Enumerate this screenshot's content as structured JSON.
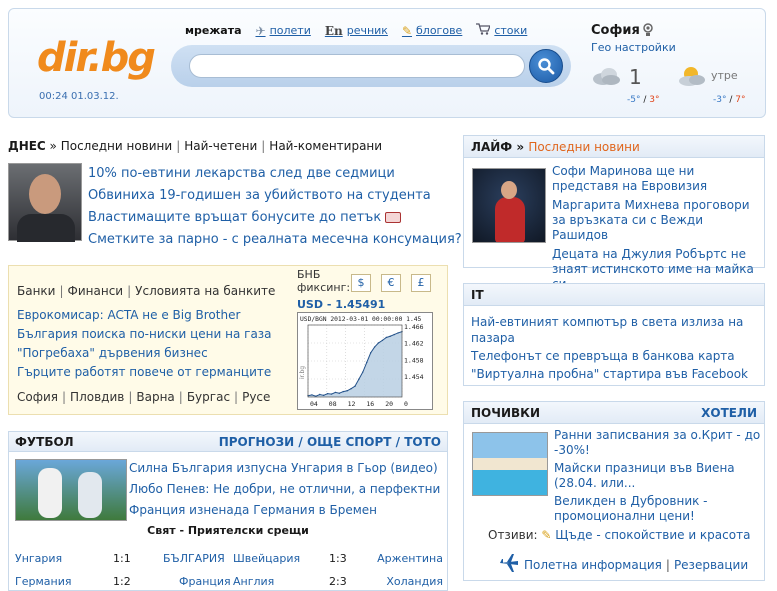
{
  "header": {
    "logo": "dir.bg",
    "clock": "00:24 01.03.12.",
    "tabs": [
      {
        "label": "мрежата",
        "icon": ""
      },
      {
        "label": "полети",
        "icon": "airplane-icon"
      },
      {
        "label": "речник",
        "icon": "En"
      },
      {
        "label": "блогове",
        "icon": "pencil-icon"
      },
      {
        "label": "стоки",
        "icon": "cart-icon"
      }
    ],
    "search": {
      "placeholder": "",
      "value": ""
    }
  },
  "weather": {
    "city": "София",
    "geo_link": "Гео настройки",
    "today": {
      "value": "1",
      "min": "-5°",
      "max": "3°"
    },
    "tomorrow": {
      "label": "утре",
      "min": "-3°",
      "max": "7°"
    }
  },
  "today": {
    "heading": "ДНЕС",
    "links": [
      "Последни новини",
      "Най-четени",
      "Най-коментирани"
    ],
    "headlines": [
      "10% по-евтини лекарства след две седмици",
      "Обвиниха 19-годишен за убийството на студента",
      "Властимащите връщат бонусите до петък",
      "Сметките за парно - с реалната месечна консумация?"
    ]
  },
  "finance": {
    "categories": [
      "Банки",
      "Финанси",
      "Условията на банките"
    ],
    "headlines": [
      "Еврокомисар: ACTA не е Big Brother",
      "България поиска по-ниски цени на газа",
      "\"Погребаха\" дървения бизнес",
      "Гърците работят повече от германците"
    ],
    "cities": [
      "София",
      "Пловдив",
      "Варна",
      "Бургас",
      "Русе"
    ],
    "bnb_label_1": "БНБ",
    "bnb_label_2": "фиксинг:",
    "currencies": [
      "$",
      "€",
      "£"
    ],
    "usd_rate": "USD - 1.45491",
    "chart_title": "USD/BGN 2012-03-01 00:00:00 1.45",
    "chart_watermark": "ir.bg"
  },
  "chart_data": {
    "type": "line",
    "title": "USD/BGN 2012-03-01 00:00:00 1.45",
    "xlabel": "",
    "ylabel": "",
    "x_tick_labels": [
      "04",
      "08",
      "12",
      "16",
      "20",
      "0"
    ],
    "y_tick_labels": [
      "1.466",
      "1.462",
      "1.458",
      "1.454"
    ],
    "y": [
      1.4495,
      1.4497,
      1.4494,
      1.4498,
      1.4496,
      1.45,
      1.4499,
      1.4503,
      1.4501,
      1.4505,
      1.4507,
      1.4512,
      1.4518,
      1.4535,
      1.4552,
      1.4575,
      1.4598,
      1.4612,
      1.4622,
      1.4628,
      1.4635,
      1.4638,
      1.4642,
      1.4646,
      1.4649
    ],
    "ylim": [
      1.4492,
      1.4665
    ],
    "grid": true
  },
  "football": {
    "title": "ФУТБОЛ",
    "links": [
      "ПРОГНОЗИ",
      "ОЩЕ СПОРТ",
      "ТОТО"
    ],
    "headlines": [
      "Силна България изпусна Унгария в Гьор (видео)",
      "Любо Пенев: Не добри, не отлични, а перфектни",
      "Франция изненада Германия в Бремен"
    ],
    "subtitle": "Свят - Приятелски срещи",
    "matches": [
      {
        "home": "Унгария",
        "score": "1:1",
        "away": "БЪЛГАРИЯ",
        "home2": "Швейцария",
        "score2": "1:3",
        "away2": "Аржентина"
      },
      {
        "home": "Германия",
        "score": "1:2",
        "away": "Франция",
        "home2": "Англия",
        "score2": "2:3",
        "away2": "Холандия"
      }
    ]
  },
  "life": {
    "title": "ЛАЙФ",
    "sub": "Последни новини",
    "headlines": [
      "Софи Маринова ще ни представя на Евровизия",
      "Маргарита Михнева проговори за връзката си с Вежди Рашидов",
      "Децата на Джулия Робъртс не знаят истинското име на майка си"
    ]
  },
  "it": {
    "title": "IT",
    "headlines": [
      "Най-евтиният компютър в света излиза на пазара",
      "Телефонът се превръща в банкова карта",
      "\"Виртуална пробна\" стартира във Facebook"
    ]
  },
  "rest": {
    "title": "ПОЧИВКИ",
    "right": "ХОТЕЛИ",
    "headlines": [
      "Ранни записвания за о.Крит - до -30%!",
      "Майски празници във Виена (28.04. или...",
      "Великден в Дубровник - промоционални цени!"
    ],
    "reviews_label": "Отзиви:",
    "reviews_link": "Щъде - спокойствие и красота",
    "flight_info": "Полетна информация",
    "reservations": "Резервации"
  }
}
